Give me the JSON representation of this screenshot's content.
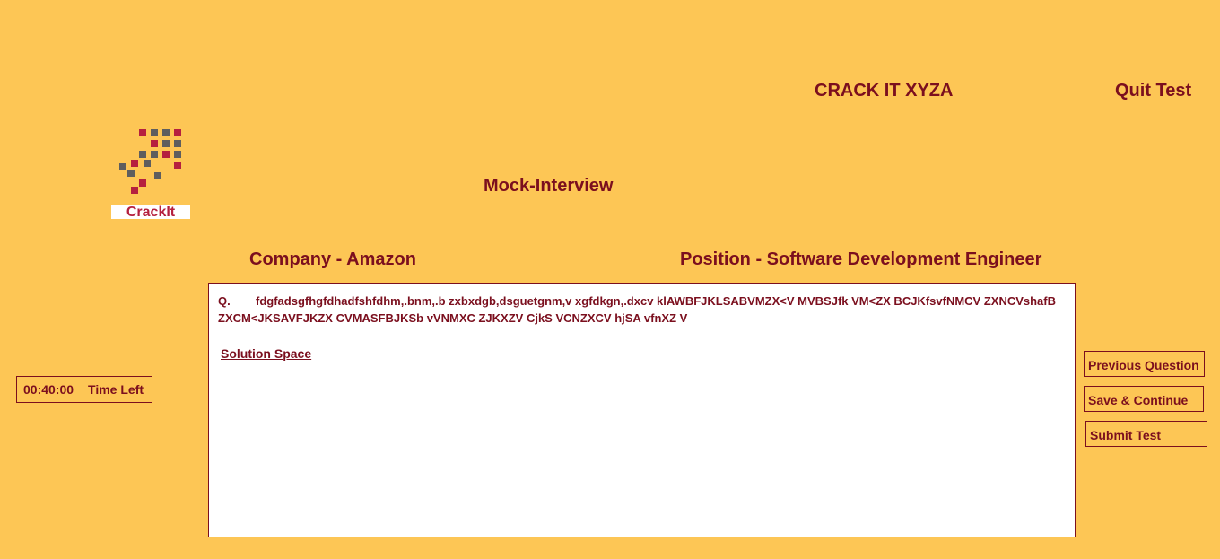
{
  "header": {
    "brand": "CRACK IT  XYZA",
    "quit_label": "Quit Test"
  },
  "logo": {
    "text": "CrackIt",
    "colors": {
      "crimson": "#B5203F",
      "gray": "#5E5E5E"
    }
  },
  "page": {
    "title": "Mock-Interview",
    "company": "Company - Amazon",
    "position": "Position - Software Development Engineer"
  },
  "question": {
    "prefix": "Q.",
    "text": "fdgfadsgfhgfdhadfshfdhm,.bnm,.b zxbxdgb,dsguetgnm,v xgfdkgn,.dxcv klAWBFJKLSABVMZX<V MVBSJfk VM<ZX BCJKfsvfNMCV ZXNCVshafB ZXCM<JKSAVFJKZX CVMASFBJKSb vVNMXC ZJKXZV CjkS VCNZXCV hjSA vfnXZ V",
    "solution_label": "Solution Space",
    "solution_value": ""
  },
  "timer": {
    "value": "00:40:00",
    "label": "Time Left"
  },
  "actions": {
    "previous_label": "Previous Question",
    "save_label": "Save & Continue",
    "submit_label": "Submit Test"
  },
  "colors": {
    "background": "#FDC655",
    "text": "#7B0F1E",
    "panel": "#FFFFFF"
  }
}
